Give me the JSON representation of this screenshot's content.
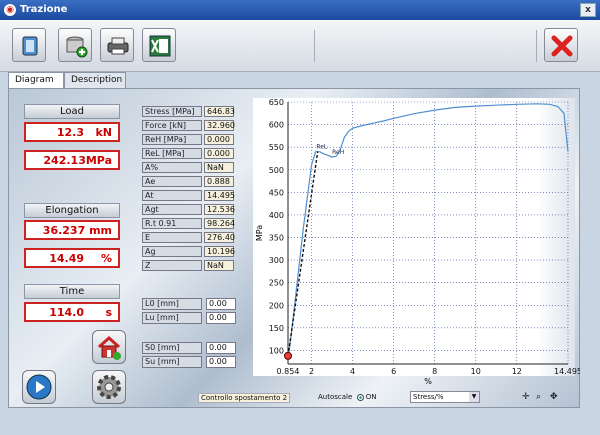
{
  "window": {
    "title": "Trazione",
    "close_glyph": "x"
  },
  "toolbar": {
    "buttons": [
      "open-icon",
      "database-add-icon",
      "printer-icon",
      "excel-icon"
    ],
    "close": "close-icon"
  },
  "tabs": [
    {
      "label": "Diagram",
      "active": true
    },
    {
      "label": "Description",
      "active": false
    }
  ],
  "load": {
    "title": "Load",
    "force_value": "12.3",
    "force_unit": "kN",
    "stress_value": "242.13MPa"
  },
  "elongation": {
    "title": "Elongation",
    "mm_value": "36.237 mm",
    "pct_value": "14.49",
    "pct_unit": "%"
  },
  "time": {
    "title": "Time",
    "value": "114.0",
    "unit": "s"
  },
  "params": [
    {
      "label": "Stress [MPa]",
      "value": "646.83"
    },
    {
      "label": "Force [kN]",
      "value": "32.960"
    },
    {
      "label": "ReH [MPa]",
      "value": "0.000"
    },
    {
      "label": "ReL [MPa]",
      "value": "0.000"
    },
    {
      "label": "A%",
      "value": "NaN"
    },
    {
      "label": "Ae",
      "value": "0.888"
    },
    {
      "label": "At",
      "value": "14.495"
    },
    {
      "label": "Agt",
      "value": "12.536"
    },
    {
      "label": "R.t 0.91",
      "value": "98.264"
    },
    {
      "label": "E",
      "value": "276.40"
    },
    {
      "label": "Ag",
      "value": "10.196"
    },
    {
      "label": "Z",
      "value": "NaN"
    }
  ],
  "inputs": [
    {
      "label": "L0 [mm]",
      "value": "0.00"
    },
    {
      "label": "Lu [mm]",
      "value": "0.00"
    },
    {
      "label": "S0 [mm]",
      "value": "0.00"
    },
    {
      "label": "Su [mm]",
      "value": "0.00"
    }
  ],
  "bottom": {
    "status": "Controllo spostamento 2",
    "autoscale_label": "Autoscale",
    "autoscale_state": "ON",
    "plot_select": "Stress/%"
  },
  "chart_data": {
    "type": "line",
    "xlabel": "%",
    "ylabel": "MPa",
    "xlim": [
      0.854,
      14.495
    ],
    "ylim": [
      70,
      650
    ],
    "xticks": [
      "0.854",
      "2",
      "4",
      "6",
      "8",
      "10",
      "12",
      "14.495"
    ],
    "xtick_values": [
      0.854,
      2,
      4,
      6,
      8,
      10,
      12,
      14.495
    ],
    "yticks": [
      100,
      150,
      200,
      250,
      300,
      350,
      400,
      450,
      500,
      550,
      600,
      650
    ],
    "grid": true,
    "series": [
      {
        "color": "#4f8fcf",
        "x": [
          0.854,
          0.9,
          1.0,
          1.2,
          1.4,
          1.6,
          1.8,
          2.0,
          2.2,
          2.4,
          2.6,
          2.8,
          3.0,
          3.2,
          3.4,
          3.6,
          3.8,
          4.0,
          4.5,
          5.0,
          5.5,
          6.0,
          7.0,
          8.0,
          9.0,
          10.0,
          11.0,
          12.0,
          13.0,
          13.6,
          14.0,
          14.3,
          14.495
        ],
        "y": [
          88,
          95,
          130,
          210,
          290,
          370,
          440,
          510,
          540,
          540,
          535,
          532,
          528,
          530,
          545,
          572,
          585,
          592,
          598,
          603,
          608,
          614,
          624,
          632,
          638,
          641,
          643,
          645,
          646,
          645,
          640,
          625,
          540
        ]
      }
    ],
    "annotations": [
      {
        "x": 0.854,
        "y": 88,
        "marker": "circle",
        "color": "#e04040"
      },
      {
        "x": 2.5,
        "y": 540,
        "marker": "label",
        "text": "ReL"
      },
      {
        "x": 3.3,
        "y": 528,
        "marker": "label",
        "text": "ReH"
      }
    ],
    "elastic_fit": {
      "x": [
        0.854,
        2.3
      ],
      "y": [
        88,
        540
      ],
      "style": "dashed",
      "color": "#111"
    }
  }
}
